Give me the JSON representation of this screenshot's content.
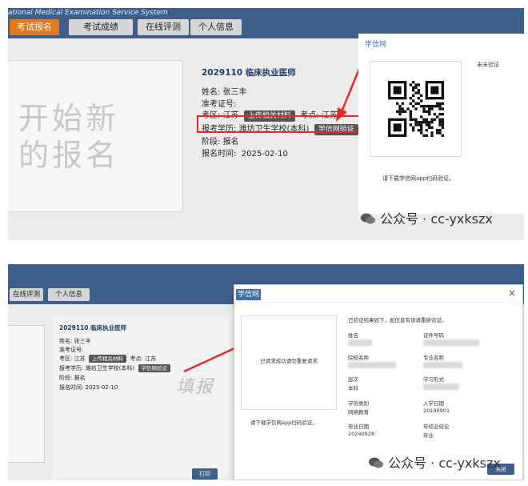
{
  "top": {
    "system_name": "ational Medical Examination Service System",
    "nav": [
      "考试报名",
      "考试成绩",
      "在线评测",
      "个人信息"
    ],
    "big_text": [
      "开始新",
      "的报名"
    ],
    "info": {
      "title": "2029110 临床执业医师",
      "name_label": "姓名:",
      "name_value": "张三丰",
      "ticket_label": "准考证号:",
      "region_label": "考区:",
      "region_value": "江苏",
      "upload_chip": "上传相关材料",
      "site_label": "考点:",
      "site_value": "江苏",
      "edu_label": "报考学历:",
      "edu_value": "潍坊卫生学校(本科)",
      "verify_chip": "学信网验证",
      "stage_label": "阶段:",
      "stage_value": "报名",
      "time_label": "报名时间:",
      "time_value": "2025-02-10"
    },
    "qr": {
      "title": "学信网",
      "side_text": "未未验证",
      "hint": "请下载学信网app扫码验证。"
    },
    "watermark": "公众号 · cc-yxkszx"
  },
  "bottom": {
    "nav": [
      "在线评测",
      "个人信息"
    ],
    "info": {
      "title": "2029110 临床执业医师",
      "name_line": "姓名:  张三丰",
      "ticket_line": "准考证号:",
      "region_label": "考区:  江苏",
      "upload_chip": "上传相关材料",
      "site_label": "考点:  江苏",
      "edu_label": "报考学历:  潍坊卫生学校(本科)",
      "verify_chip": "学信网验证",
      "stage_line": "阶段:  报名",
      "time_line": "报名时间:  2025-02-10"
    },
    "big_char": "填报",
    "print_button": "打印",
    "modal": {
      "title": "学信网",
      "close": "×",
      "request_text": "已请求成功请勿重复请求",
      "hint": "请下载学信网app扫码验证。",
      "summary": "已验证结果如下，如信息有误请重新验证。",
      "fields": [
        {
          "label": "姓名",
          "value": ""
        },
        {
          "label": "证件号码",
          "value": ""
        },
        {
          "label": "院校名称",
          "value": ""
        },
        {
          "label": "专业名称",
          "value": ""
        },
        {
          "label": "层次",
          "value": "本科"
        },
        {
          "label": "学习形式",
          "value": ""
        },
        {
          "label": "学历类别",
          "value": "网络教育"
        },
        {
          "label": "入学日期",
          "value": "20190901"
        },
        {
          "label": "毕业日期",
          "value": "20240928"
        },
        {
          "label": "毕结业结论",
          "value": "毕业"
        }
      ],
      "close_button": "关闭"
    },
    "watermark": "公众号 · cc-yxkszx"
  },
  "colors": {
    "header": "#3d5f8a",
    "active_tab": "#e07a1f",
    "highlight": "#e52a2a",
    "chip": "#555555"
  }
}
